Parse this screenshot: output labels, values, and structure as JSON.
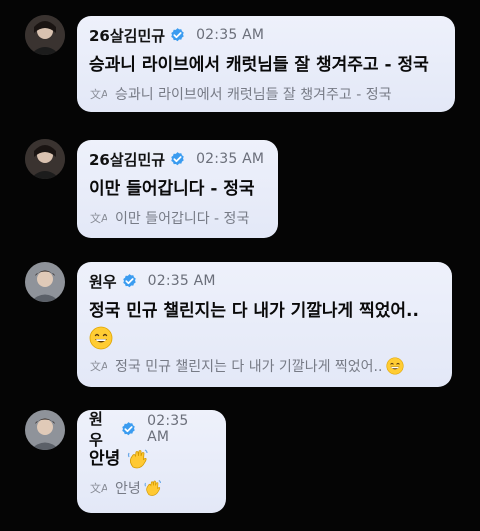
{
  "messages": [
    {
      "author": "26살김민규",
      "time": "02:35 AM",
      "text": "승과니 라이브에서 캐럿님들 잘 챙겨주고 - 정국",
      "translation": "승과니 라이브에서 캐럿님들 잘 챙겨주고 - 정국"
    },
    {
      "author": "26살김민규",
      "time": "02:35 AM",
      "text": "이만 들어갑니다 - 정국",
      "translation": "이만 들어갑니다 - 정국"
    },
    {
      "author": "원우",
      "time": "02:35 AM",
      "text": "정국 민규 챌린지는 다 내가 기깔나게 찍었어..",
      "translation": "정국 민규 챌린지는 다 내가 기깔나게 찍었어..",
      "emoji": "grinning-face"
    },
    {
      "author": "원우",
      "time": "02:35 AM",
      "text": "안녕",
      "translation": "안녕",
      "emoji": "waving-hand"
    }
  ],
  "colors": {
    "background": "#050505",
    "bubble": "#e8ecf9",
    "verified": "#3b9cf0"
  }
}
